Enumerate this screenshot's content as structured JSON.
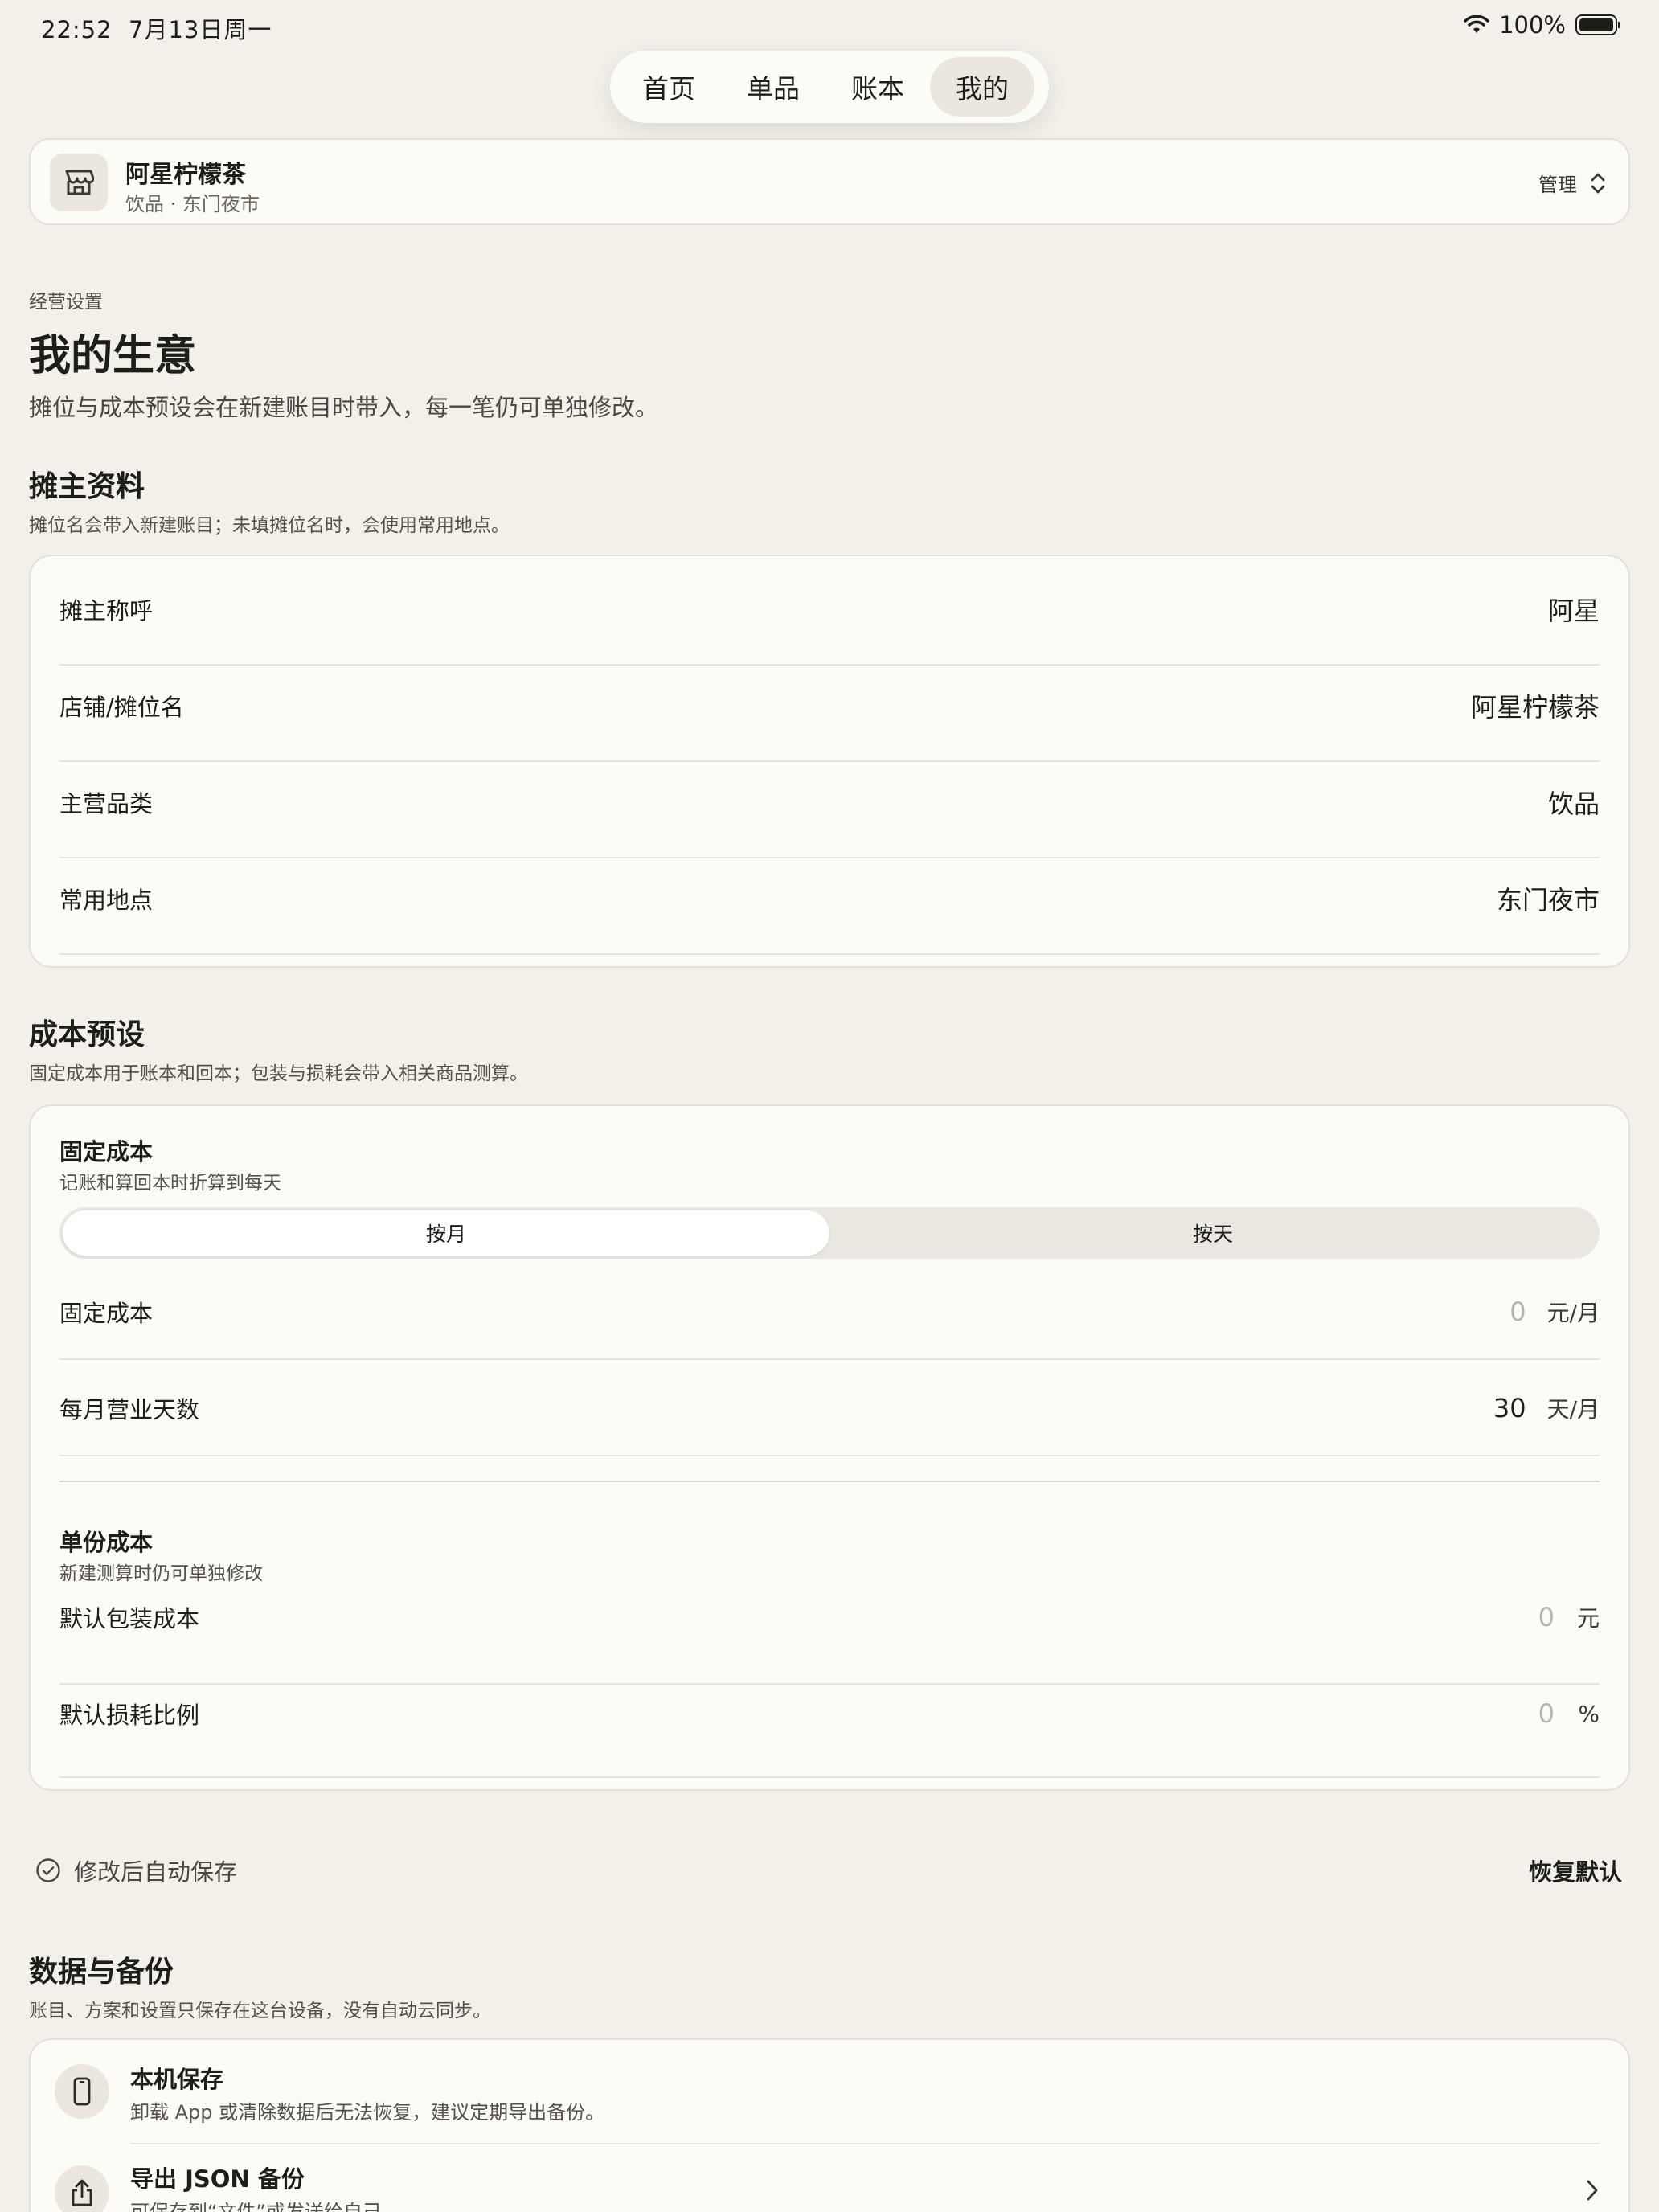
{
  "status": {
    "time": "22:52",
    "date": "7月13日周一",
    "battery": "100%"
  },
  "tabs": [
    {
      "label": "首页"
    },
    {
      "label": "单品"
    },
    {
      "label": "账本"
    },
    {
      "label": "我的",
      "active": true
    }
  ],
  "store": {
    "name": "阿星柠檬茶",
    "subtitle": "饮品 · 东门夜市",
    "manage_label": "管理"
  },
  "header": {
    "eyebrow": "经营设置",
    "title": "我的生意",
    "description": "摊位与成本预设会在新建账目时带入，每一笔仍可单独修改。"
  },
  "owner": {
    "title": "摊主资料",
    "description": "摊位名会带入新建账目；未填摊位名时，会使用常用地点。",
    "rows": [
      {
        "label": "摊主称呼",
        "value": "阿星"
      },
      {
        "label": "店铺/摊位名",
        "value": "阿星柠檬茶"
      },
      {
        "label": "主营品类",
        "value": "饮品"
      },
      {
        "label": "常用地点",
        "value": "东门夜市"
      }
    ]
  },
  "cost": {
    "title": "成本预设",
    "description": "固定成本用于账本和回本；包装与损耗会带入相关商品测算。",
    "fixed": {
      "title": "固定成本",
      "description": "记账和算回本时折算到每天",
      "segments": [
        "按月",
        "按天"
      ],
      "selected_segment": "按月",
      "rows": [
        {
          "label": "固定成本",
          "value": "0",
          "unit": "元/月",
          "placeholder": true
        },
        {
          "label": "每月营业天数",
          "value": "30",
          "unit": "天/月",
          "placeholder": false
        }
      ]
    },
    "unit": {
      "title": "单份成本",
      "description": "新建测算时仍可单独修改",
      "rows": [
        {
          "label": "默认包装成本",
          "value": "0",
          "unit": "元",
          "placeholder": true
        },
        {
          "label": "默认损耗比例",
          "value": "0",
          "unit": "%",
          "placeholder": true
        }
      ]
    }
  },
  "autosave": {
    "label": "修改后自动保存",
    "restore_label": "恢复默认"
  },
  "data": {
    "title": "数据与备份",
    "description": "账目、方案和设置只保存在这台设备，没有自动云同步。",
    "items": [
      {
        "icon": "phone-icon",
        "title": "本机保存",
        "description": "卸载 App 或清除数据后无法恢复，建议定期导出备份。"
      },
      {
        "icon": "share-icon",
        "title": "导出 JSON 备份",
        "description": "可保存到“文件”或发送给自己"
      }
    ]
  }
}
